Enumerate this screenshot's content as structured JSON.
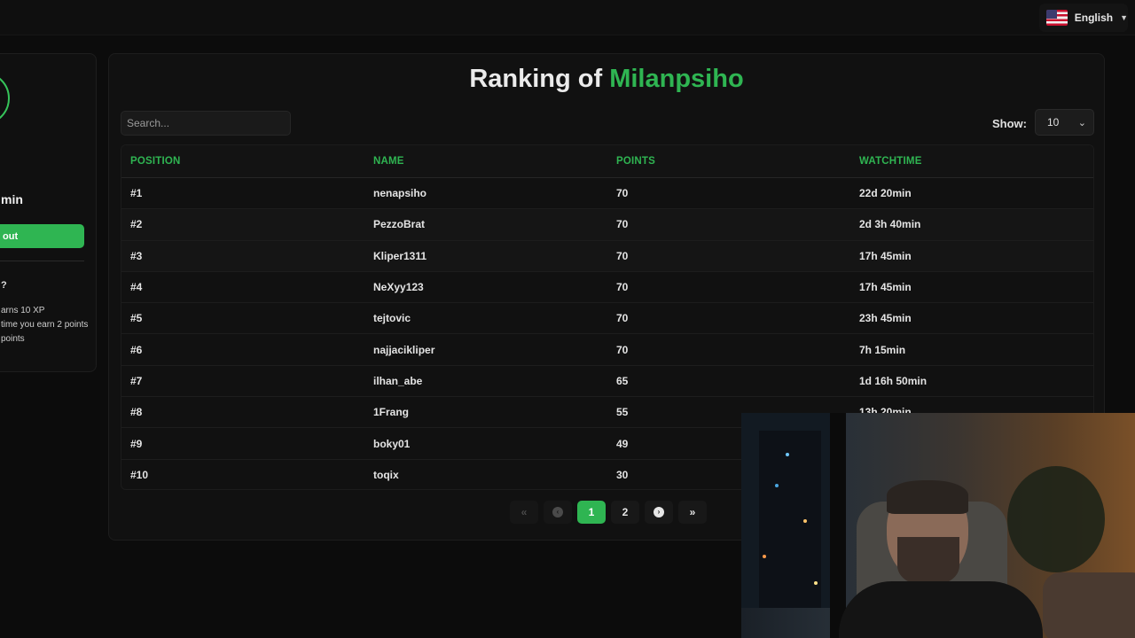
{
  "language": {
    "label": "English",
    "flag": "us-flag-icon"
  },
  "profile": {
    "watchtime_fragment": "min",
    "button_label": "out",
    "qmark": "?",
    "info_lines": [
      "arns 10 XP",
      "time you earn 2 points",
      "points"
    ]
  },
  "main": {
    "title_prefix": "Ranking of",
    "title_name": "Milanpsiho",
    "search_placeholder": "Search...",
    "show_label": "Show:",
    "show_value": "10"
  },
  "table": {
    "headers": [
      "POSITION",
      "NAME",
      "POINTS",
      "WATCHTIME"
    ],
    "rows": [
      {
        "position": "#1",
        "name": "nenapsiho",
        "points": "70",
        "watchtime": "22d 20min"
      },
      {
        "position": "#2",
        "name": "PezzoBrat",
        "points": "70",
        "watchtime": "2d 3h 40min"
      },
      {
        "position": "#3",
        "name": "Kliper1311",
        "points": "70",
        "watchtime": "17h 45min"
      },
      {
        "position": "#4",
        "name": "NeXyy123",
        "points": "70",
        "watchtime": "17h 45min"
      },
      {
        "position": "#5",
        "name": "tejtovic",
        "points": "70",
        "watchtime": "23h 45min"
      },
      {
        "position": "#6",
        "name": "najjacikliper",
        "points": "70",
        "watchtime": "7h 15min"
      },
      {
        "position": "#7",
        "name": "ilhan_abe",
        "points": "65",
        "watchtime": "1d 16h 50min"
      },
      {
        "position": "#8",
        "name": "1Frang",
        "points": "55",
        "watchtime": "13h 20min"
      },
      {
        "position": "#9",
        "name": "boky01",
        "points": "49",
        "watchtime": ""
      },
      {
        "position": "#10",
        "name": "toqix",
        "points": "30",
        "watchtime": ""
      }
    ]
  },
  "pagination": {
    "first": "«",
    "prev": "‹",
    "pages": [
      "1",
      "2"
    ],
    "active_page": "1",
    "next": "›",
    "last": "»"
  },
  "colors": {
    "accent": "#2fb552",
    "background": "#0c0c0c",
    "card": "#111111"
  }
}
